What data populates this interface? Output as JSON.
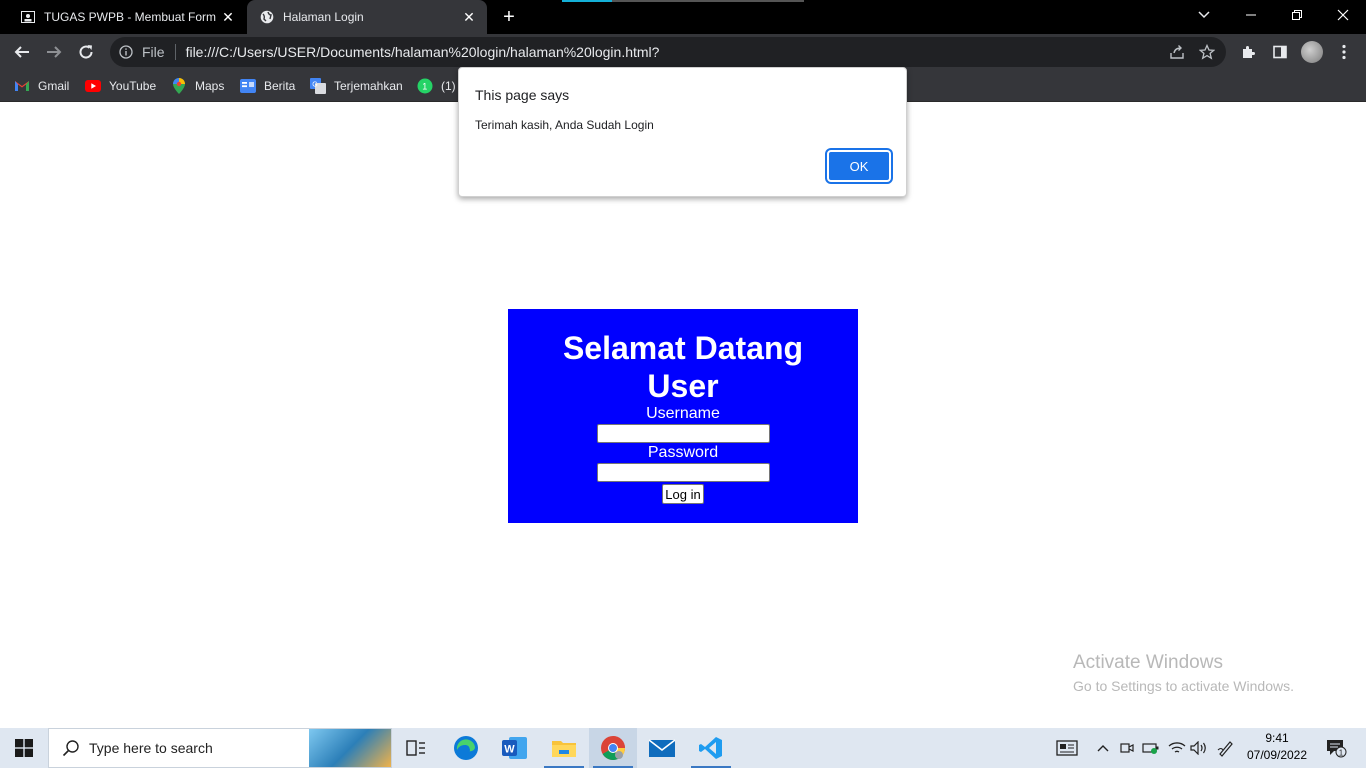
{
  "browser": {
    "tabs": [
      {
        "title": "TUGAS PWPB - Membuat Form L",
        "active": false
      },
      {
        "title": "Halaman Login",
        "active": true
      }
    ],
    "address": {
      "scheme_label": "File",
      "url": "file:///C:/Users/USER/Documents/halaman%20login/halaman%20login.html?"
    },
    "bookmarks": [
      {
        "label": "Gmail",
        "icon": "gmail-icon"
      },
      {
        "label": "YouTube",
        "icon": "youtube-icon"
      },
      {
        "label": "Maps",
        "icon": "maps-icon"
      },
      {
        "label": "Berita",
        "icon": "news-icon"
      },
      {
        "label": "Terjemahkan",
        "icon": "translate-icon"
      },
      {
        "label": "(1)",
        "icon": "whatsapp-icon"
      }
    ]
  },
  "dialog": {
    "title": "This page says",
    "message": "Terimah kasih, Anda Sudah Login",
    "ok_label": "OK"
  },
  "login": {
    "heading_line1": "Selamat Datang",
    "heading_line2": "User",
    "username_label": "Username",
    "username_value": "",
    "password_label": "Password",
    "password_value": "",
    "submit_label": "Log in",
    "background_color": "#0000ff"
  },
  "watermark": {
    "line1": "Activate Windows",
    "line2": "Go to Settings to activate Windows."
  },
  "taskbar": {
    "search_placeholder": "Type here to search",
    "apps": [
      "task-view-icon",
      "edge-icon",
      "word-icon",
      "file-explorer-icon",
      "chrome-icon",
      "mail-icon",
      "vscode-icon"
    ],
    "time": "9:41",
    "date": "07/09/2022",
    "notification_count": "1"
  }
}
